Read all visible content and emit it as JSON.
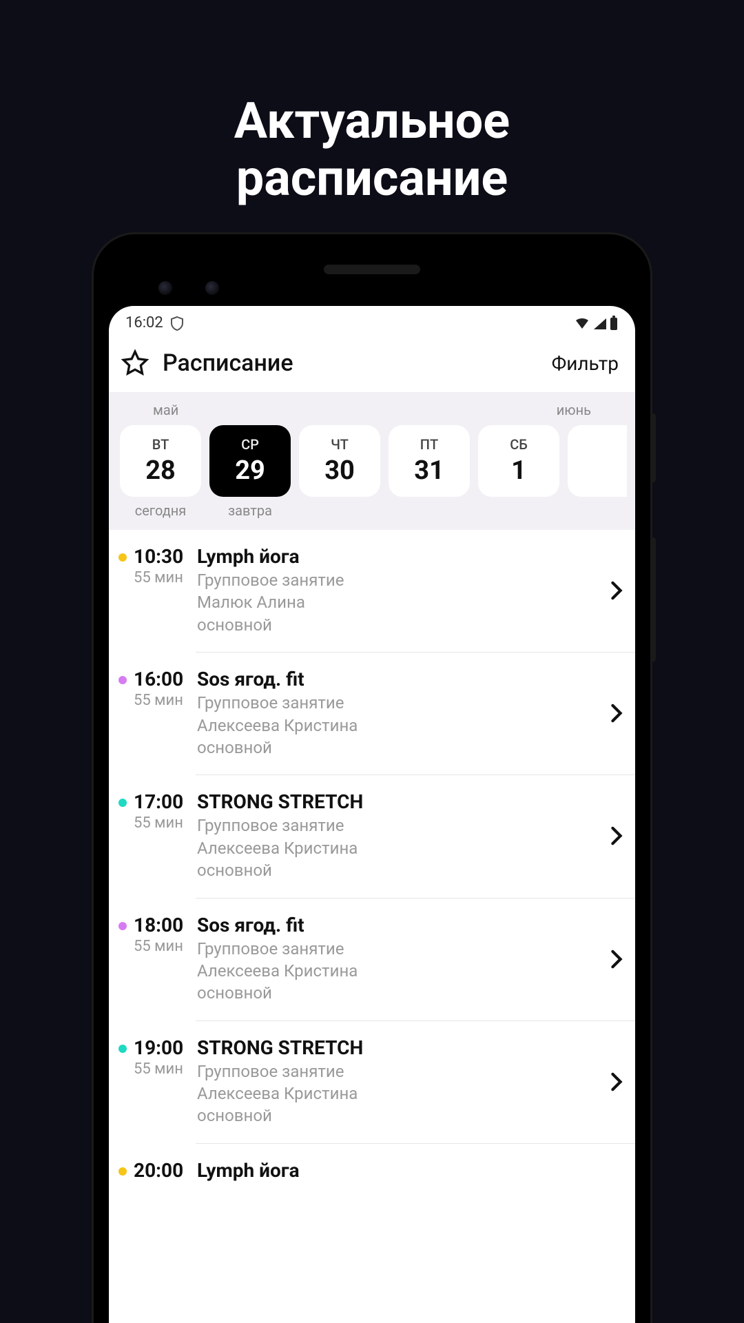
{
  "promo": {
    "line1": "Актуальное",
    "line2": "расписание"
  },
  "status": {
    "time": "16:02"
  },
  "appbar": {
    "title": "Расписание",
    "filter": "Фильтр"
  },
  "dates": {
    "month_left": "май",
    "month_right": "июнь",
    "tiles": [
      {
        "dow": "ВТ",
        "num": "28",
        "selected": false,
        "label": "сегодня"
      },
      {
        "dow": "СР",
        "num": "29",
        "selected": true,
        "label": "завтра"
      },
      {
        "dow": "ЧТ",
        "num": "30",
        "selected": false,
        "label": ""
      },
      {
        "dow": "ПТ",
        "num": "31",
        "selected": false,
        "label": ""
      },
      {
        "dow": "СБ",
        "num": "1",
        "selected": false,
        "label": ""
      },
      {
        "dow": "",
        "num": "",
        "selected": false,
        "label": ""
      }
    ]
  },
  "events": [
    {
      "dot": "#f5c518",
      "time": "10:30",
      "dur": "55 мин",
      "name": "Lymph йога",
      "type": "Групповое занятие",
      "trainer": "Малюк Алина",
      "room": "основной"
    },
    {
      "dot": "#d67cf2",
      "time": "16:00",
      "dur": "55 мин",
      "name": "Sos ягод. fit",
      "type": "Групповое занятие",
      "trainer": "Алексеева Кристина",
      "room": "основной"
    },
    {
      "dot": "#1fd9c2",
      "time": "17:00",
      "dur": "55 мин",
      "name": "STRONG STRETCH",
      "type": "Групповое занятие",
      "trainer": "Алексеева Кристина",
      "room": "основной"
    },
    {
      "dot": "#d67cf2",
      "time": "18:00",
      "dur": "55 мин",
      "name": "Sos ягод. fit",
      "type": "Групповое занятие",
      "trainer": "Алексеева Кристина",
      "room": "основной"
    },
    {
      "dot": "#1fd9c2",
      "time": "19:00",
      "dur": "55 мин",
      "name": "STRONG STRETCH",
      "type": "Групповое занятие",
      "trainer": "Алексеева Кристина",
      "room": "основной"
    },
    {
      "dot": "#f5c518",
      "time": "20:00",
      "dur": "",
      "name": "Lymph йога",
      "type": "",
      "trainer": "",
      "room": ""
    }
  ]
}
